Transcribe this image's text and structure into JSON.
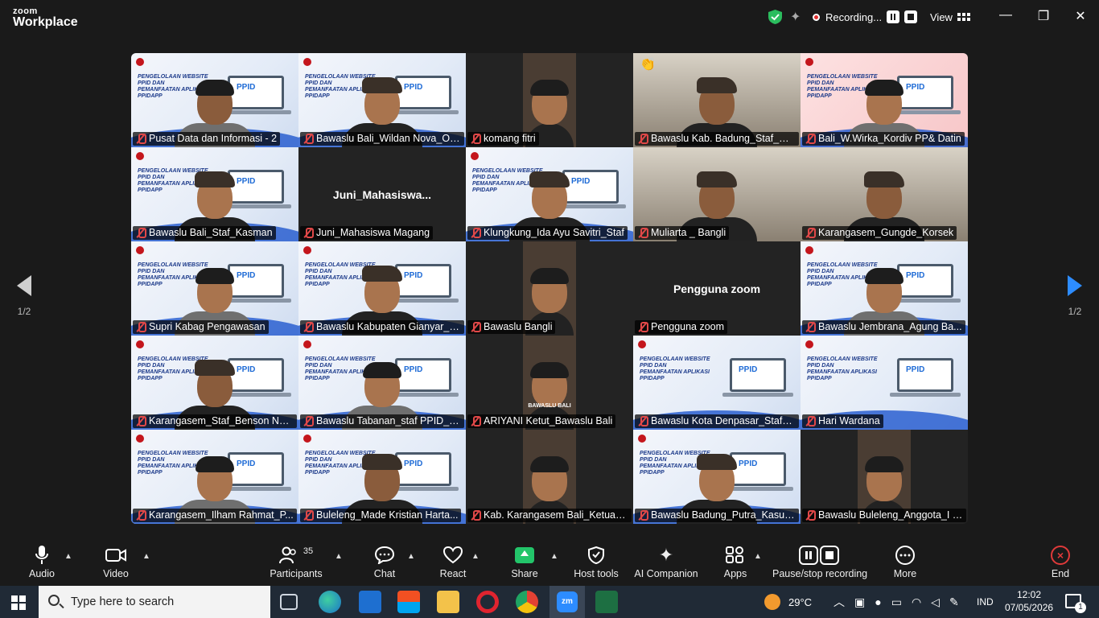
{
  "app": {
    "brand_top": "zoom",
    "brand_bottom": "Workplace"
  },
  "titlebar": {
    "recording_label": "Recording...",
    "view_label": "View",
    "colors": {
      "shield": "#2bbd5e",
      "record_dot": "#e02f2f"
    }
  },
  "gallery": {
    "tiles": [
      {
        "name": "Pusat Data dan Informasi - 2",
        "type": "slide"
      },
      {
        "name": "Bawaslu Bali_Wildan Nova_Opera...",
        "type": "slide",
        "active": true
      },
      {
        "name": "komang fitri",
        "type": "photo"
      },
      {
        "name": "Bawaslu Kab. Badung_Staf_Ok...",
        "type": "room",
        "reaction": "👏"
      },
      {
        "name": "Bali_W.Wirka_Kordiv PP& Datin",
        "type": "slide-pink"
      },
      {
        "name": "Bawaslu Bali_Staf_Kasman",
        "type": "slide"
      },
      {
        "name": "Juni_Mahasiswa Magang",
        "type": "nameonly",
        "big": "Juni_Mahasiswa..."
      },
      {
        "name": "Klungkung_Ida Ayu Savitri_Staf",
        "type": "slide"
      },
      {
        "name": "Muliarta _ Bangli",
        "type": "room"
      },
      {
        "name": "Karangasem_Gungde_Korsek",
        "type": "room"
      },
      {
        "name": "Supri Kabag Pengawasan",
        "type": "slide"
      },
      {
        "name": "Bawaslu Kabupaten Gianyar_K...",
        "type": "slide"
      },
      {
        "name": "Bawaslu Bangli",
        "type": "photo"
      },
      {
        "name": "Pengguna zoom",
        "type": "nameonly",
        "big": "Pengguna zoom"
      },
      {
        "name": "Bawaslu Jembrana_Agung Ba...",
        "type": "slide"
      },
      {
        "name": "Karangasem_Staf_Benson Nar...",
        "type": "slide"
      },
      {
        "name": "Bawaslu Tabanan_staf PPID_G...",
        "type": "slide"
      },
      {
        "name": "ARIYANI Ketut_Bawaslu Bali",
        "type": "photo",
        "caption": "BAWASLU BALI"
      },
      {
        "name": "Bawaslu Kota Denpasar_Staf_...",
        "type": "slide-empty"
      },
      {
        "name": "Hari Wardana",
        "type": "slide-empty"
      },
      {
        "name": "Karangasem_Ilham Rahmat_P...",
        "type": "slide"
      },
      {
        "name": "Buleleng_Made Kristian Harta...",
        "type": "slide"
      },
      {
        "name": "Kab. Karangasem Bali_Ketua_...",
        "type": "photo"
      },
      {
        "name": "Bawaslu Badung_Putra_Kasub...",
        "type": "slide"
      },
      {
        "name": "Bawaslu Buleleng_Anggota_I K...",
        "type": "photo"
      }
    ],
    "slide_text": "PENGELOLAAN WEBSITE PPID DAN PEMANFAATAN APLIKASI PPIDAPP",
    "slide_brand": "PPID",
    "pagination": {
      "left": "1/2",
      "right": "1/2"
    }
  },
  "toolbar": {
    "audio": "Audio",
    "video": "Video",
    "participants": "Participants",
    "participants_count": "35",
    "chat": "Chat",
    "react": "React",
    "share": "Share",
    "host_tools": "Host tools",
    "ai_companion": "AI Companion",
    "apps": "Apps",
    "pause_stop": "Pause/stop recording",
    "more": "More",
    "end": "End"
  },
  "taskbar": {
    "search_placeholder": "Type here to search",
    "weather": "29°C",
    "language": "IND",
    "time": "12:02",
    "date": "07/05/2026",
    "notifications": "1"
  }
}
